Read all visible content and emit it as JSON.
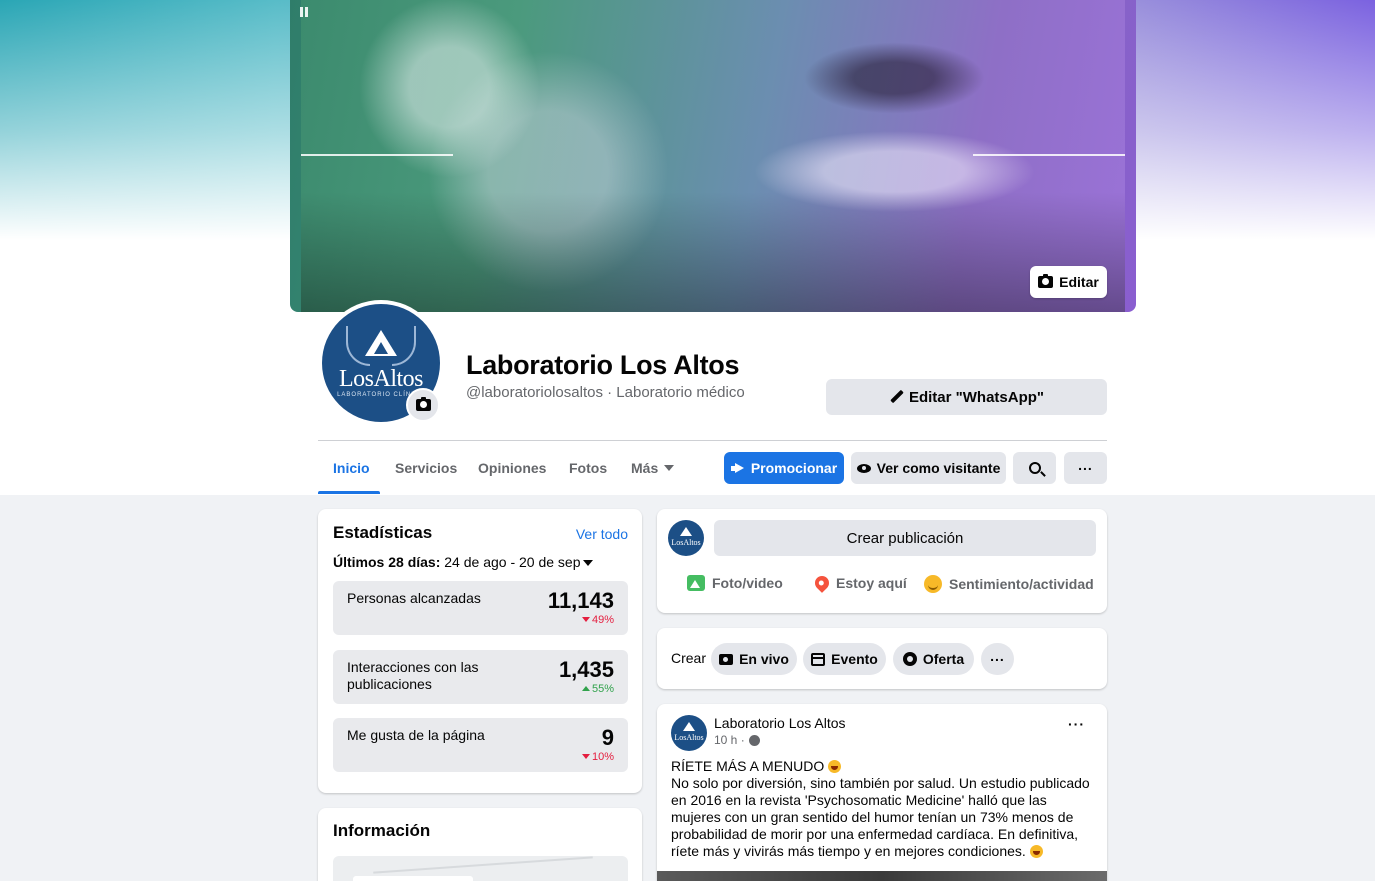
{
  "cover": {
    "edit_label": "Editar"
  },
  "page": {
    "name": "Laboratorio Los Altos",
    "handle": "@laboratoriolosaltos · Laboratorio médico",
    "logo_text": "LosAltos",
    "logo_sub": "LABORATORIO CLÍNICO",
    "edit_whatsapp": "Editar \"WhatsApp\""
  },
  "tabs": [
    {
      "label": "Inicio",
      "active": true
    },
    {
      "label": "Servicios"
    },
    {
      "label": "Opiniones"
    },
    {
      "label": "Fotos"
    },
    {
      "label": "Más"
    }
  ],
  "actions": {
    "promote": "Promocionar",
    "view_as_visitor": "Ver como visitante"
  },
  "stats": {
    "title": "Estadísticas",
    "see_all": "Ver todo",
    "range_label": "Últimos 28 días:",
    "range_value": "24 de ago - 20 de sep",
    "items": [
      {
        "label": "Personas alcanzadas",
        "value": "11,143",
        "delta": "49%",
        "direction": "down"
      },
      {
        "label": "Interacciones con las publicaciones",
        "value": "1,435",
        "delta": "55%",
        "direction": "up"
      },
      {
        "label": "Me gusta de la página",
        "value": "9",
        "delta": "10%",
        "direction": "down"
      }
    ]
  },
  "info": {
    "title": "Información"
  },
  "composer": {
    "create_post": "Crear publicación",
    "photo_video": "Foto/video",
    "check_in": "Estoy aquí",
    "feeling": "Sentimiento/actividad"
  },
  "create_bar": {
    "label": "Crear",
    "live": "En vivo",
    "event": "Evento",
    "offer": "Oferta"
  },
  "post": {
    "author": "Laboratorio Los Altos",
    "time": "10 h ·",
    "headline": "RÍETE MÁS A MENUDO",
    "body": "No solo por diversión, sino también por salud. Un estudio publicado en 2016 en la revista 'Psychosomatic Medicine' halló que las mujeres con un gran sentido del humor tenían un 73% menos de probabilidad de morir por una enfermedad cardíaca. En definitiva, ríete más y vivirás más tiempo y en mejores condiciones."
  },
  "colors": {
    "accent": "#1b74e4",
    "background": "#f0f2f5",
    "delta_down": "#e41e3f",
    "delta_up": "#31a24c",
    "logo_blue": "#1c4f86"
  }
}
